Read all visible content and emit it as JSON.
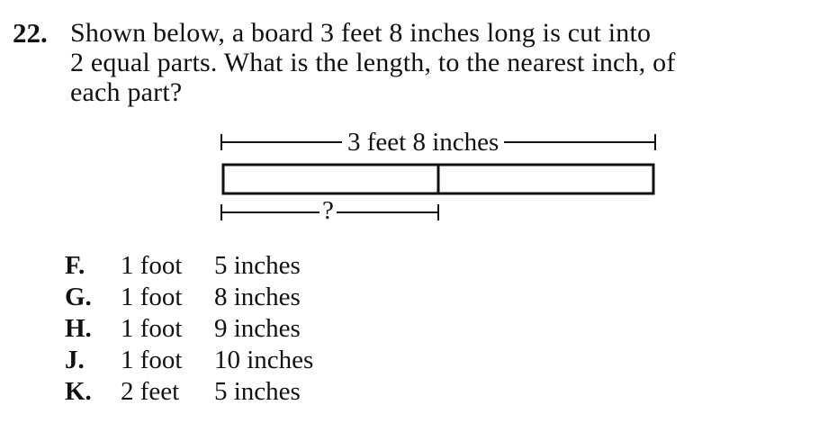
{
  "question": {
    "number": "22.",
    "lines": [
      "Shown below, a board 3 feet 8 inches long is cut into",
      "2 equal parts. What is the length, to the nearest inch, of",
      "each part?"
    ]
  },
  "figure": {
    "total_label": "3 feet 8 inches",
    "part_label": "?"
  },
  "choices": [
    {
      "letter": "F.",
      "feet": "1 foot",
      "inches": "5 inches"
    },
    {
      "letter": "G.",
      "feet": "1 foot",
      "inches": "8 inches"
    },
    {
      "letter": "H.",
      "feet": "1 foot",
      "inches": "9 inches"
    },
    {
      "letter": "J.",
      "feet": "1 foot",
      "inches": "10 inches"
    },
    {
      "letter": "K.",
      "feet": "2 feet",
      "inches": "5 inches"
    }
  ]
}
